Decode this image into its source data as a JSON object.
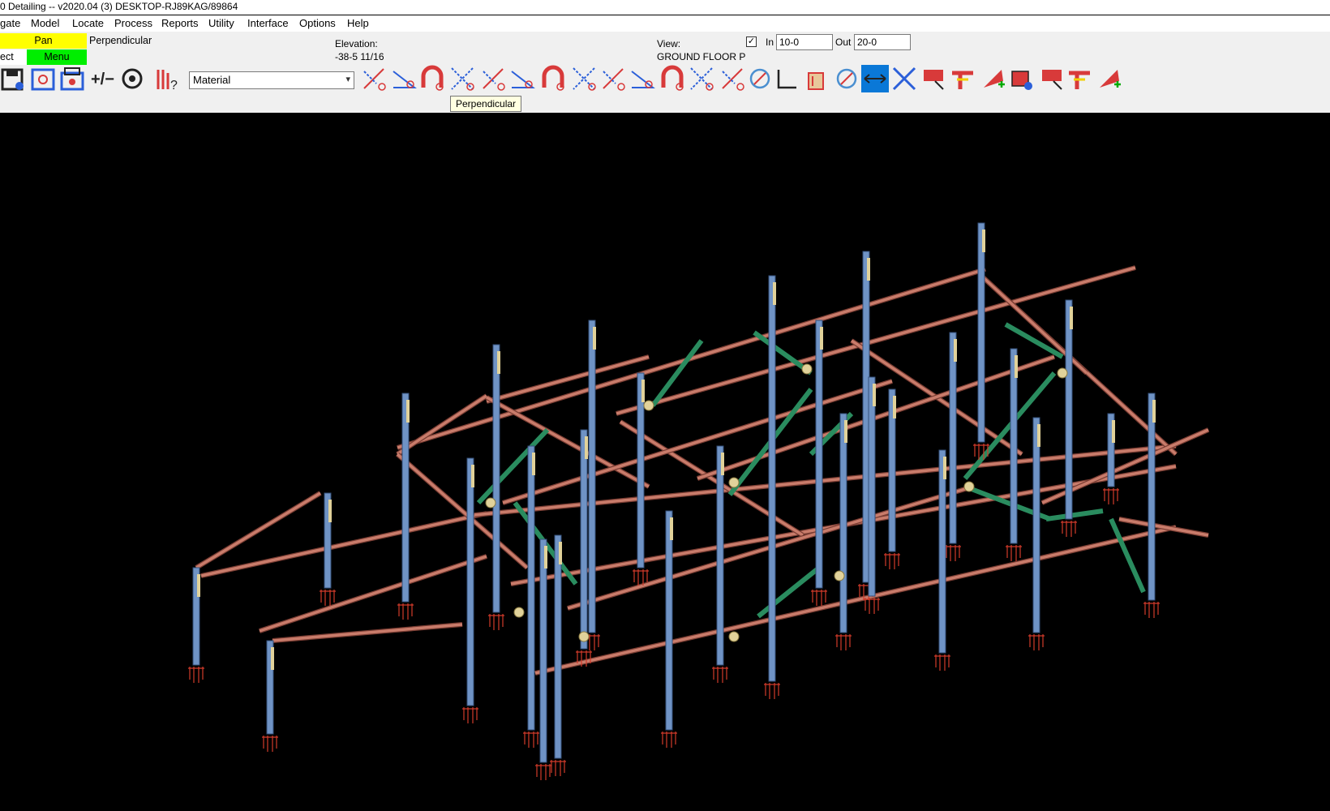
{
  "window": {
    "title": "0 Detailing  --  v2020.04  (3) DESKTOP-RJ89KAG/89864"
  },
  "menu": {
    "items": [
      "gate",
      "Model",
      "Locate",
      "Process",
      "Reports",
      "Utility",
      "Interface",
      "Options",
      "Help"
    ]
  },
  "toolbar": {
    "mode_pan": "Pan",
    "mode_perpendicular": "Perpendicular",
    "mode_select": "ect",
    "mode_menu": "Menu",
    "elevation_label": "Elevation:",
    "elevation_value": "-38-5 11/16",
    "view_label": "View:",
    "view_value": "GROUND FLOOR P",
    "in_label": "In",
    "in_value": "10-0",
    "out_label": "Out",
    "out_value": "20-0",
    "material_value": "Material",
    "tooltip": "Perpendicular",
    "colors": {
      "pan": "#ffff00",
      "menu": "#00ee00",
      "active_tool": "#0a78d7"
    },
    "tools": [
      "save-icon",
      "locate-settings-icon",
      "print-settings-icon",
      "plus-minus-icon",
      "rotate-view-icon",
      "member-help-icon",
      "magnet-snap-icon",
      "intersection-snap-icon",
      "end-snap-icon",
      "midpoint-snap-icon",
      "angle-snap-icon",
      "cross-snap-icon",
      "offset-snap-icon",
      "line-snap-icon",
      "dimension-snap-icon",
      "beam-snap-icon",
      "grid-snap-icon",
      "hand-pick-icon",
      "target-snap-icon",
      "door-frame-icon",
      "arc-snap-icon",
      "point-pick-icon",
      "angle-tool-icon",
      "move-tool-icon",
      "cross-tool-icon",
      "add-plate-icon",
      "red-material-icon",
      "column-tool-icon",
      "weld-tool-icon",
      "connection-icon",
      "add-member-icon",
      "add-roof-icon"
    ]
  }
}
